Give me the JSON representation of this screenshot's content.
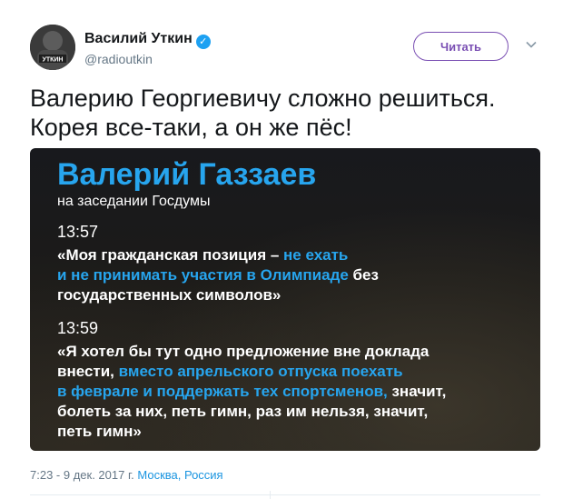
{
  "author": {
    "name": "Василий Уткин",
    "handle": "@radioutkin",
    "avatar_caption": "УТКИН"
  },
  "actions": {
    "follow_label": "Читать",
    "menu_icon": "chevron-down-icon"
  },
  "tweet": {
    "line1": "Валерию Георгиевичу сложно решиться.",
    "line2": "Корея все-таки, а он же пёс!"
  },
  "media": {
    "title": "Валерий Газзаев",
    "subtitle": "на заседании Госдумы",
    "entries": [
      {
        "time": "13:57",
        "lines": [
          {
            "text": "«Моя гражданская позиция – ",
            "hl": "не ехать"
          },
          {
            "hl": "и не принимать участия в Олимпиаде",
            "text": " без"
          },
          {
            "text": "государственных символов»"
          }
        ]
      },
      {
        "time": "13:59",
        "lines": [
          {
            "text": "«Я хотел бы тут одно предложение вне доклада"
          },
          {
            "text": "внести, ",
            "hl": "вместо апрельского отпуска поехать"
          },
          {
            "hl": "в феврале и поддержать тех спортсменов,",
            "text": " значит,"
          },
          {
            "text": "болеть за них, петь гимн, раз им нельзя, значит,"
          },
          {
            "text": "петь гимн»"
          }
        ]
      }
    ]
  },
  "footer": {
    "timestamp": "7:23 - 9 дек. 2017 г.",
    "location": "Москва, Россия"
  },
  "colors": {
    "accent_purple": "#7a4fb3",
    "verified_blue": "#1da1f2",
    "highlight_blue": "#27a5ee",
    "link_blue": "#1b95e0"
  }
}
